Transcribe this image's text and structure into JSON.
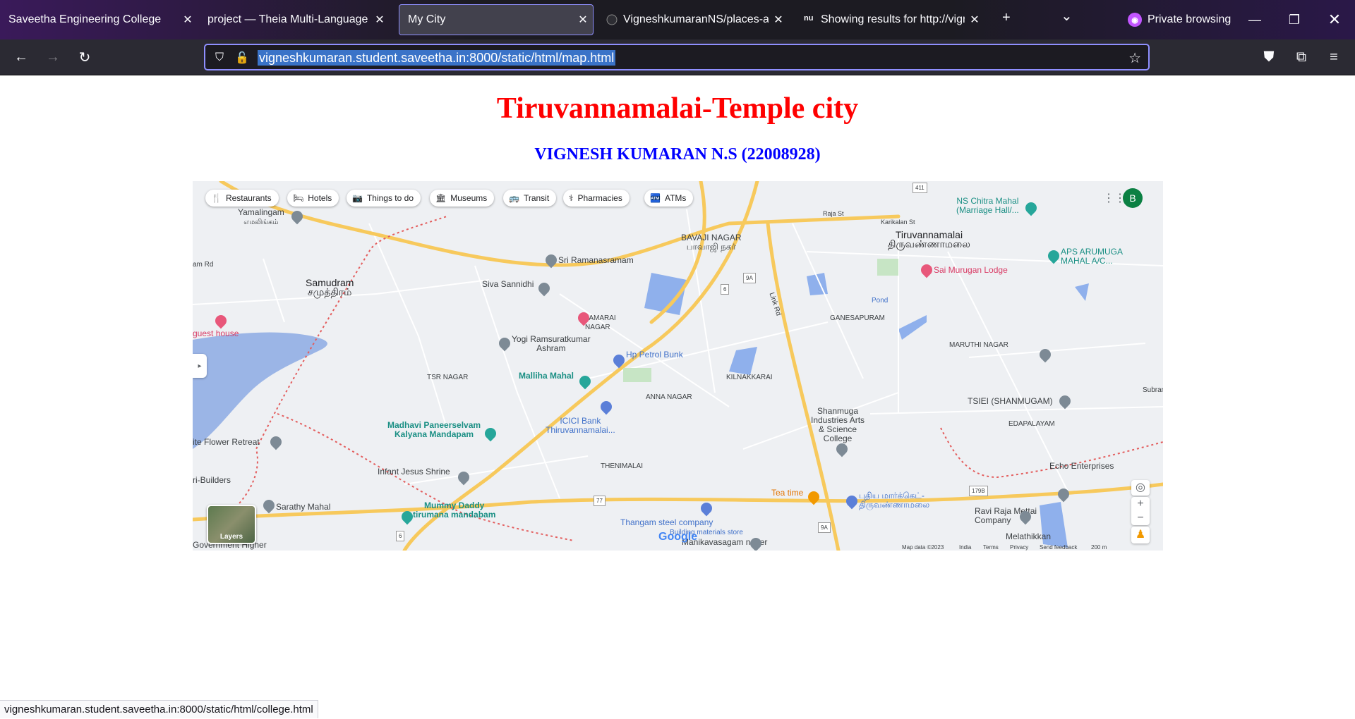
{
  "browser": {
    "tabs": [
      {
        "title": "Saveetha Engineering College",
        "icon": "saveetha-favicon",
        "active": false
      },
      {
        "title": "project — Theia Multi-Language Ex",
        "icon": "theia-favicon",
        "active": false
      },
      {
        "title": "My City",
        "icon": "page-favicon",
        "active": true
      },
      {
        "title": "VigneshkumaranNS/places-arou",
        "icon": "github-icon",
        "active": false
      },
      {
        "title": "Showing results for http://vigne",
        "icon": "nu-favicon",
        "active": false
      }
    ],
    "new_tab_symbol": "+",
    "tab_list_symbol": "⌄",
    "private_label": "Private browsing",
    "url": "vigneshkumaran.student.saveetha.in:8000/static/html/map.html",
    "status_url": "vigneshkumaran.student.saveetha.in:8000/static/html/college.html"
  },
  "page": {
    "title": "Tiruvannamalai-Temple city",
    "subtitle": "VIGNESH KUMARAN N.S (22008928)"
  },
  "map": {
    "chips": [
      {
        "label": "Restaurants",
        "icon": "fork-knife-icon"
      },
      {
        "label": "Hotels",
        "icon": "bed-icon"
      },
      {
        "label": "Things to do",
        "icon": "camera-icon"
      },
      {
        "label": "Museums",
        "icon": "museum-icon"
      },
      {
        "label": "Transit",
        "icon": "bus-icon"
      },
      {
        "label": "Pharmacies",
        "icon": "pharmacy-icon"
      },
      {
        "label": "ATMs",
        "icon": "atm-icon"
      }
    ],
    "avatar_letter": "B",
    "layers_label": "Layers",
    "places": {
      "yamalingam": "Yamalingam",
      "yamalingam_ta": "எமலிங்கம்",
      "samudram": "Samudram",
      "samudram_ta": "சமுத்திரம்",
      "bavaji_nagar": "BAVAJI NAGAR",
      "bavaji_nagar_ta": "பாவாஜி\nநகர்",
      "tiruvannamalai": "Tiruvannamalai",
      "tiruvannamalai_ta": "திருவண்ணாமலை",
      "sri_ramanasramam": "Sri Ramanasramam",
      "siva_sannidhi": "Siva Sannidhi",
      "sai_murugan_lodge": "Sai Murugan Lodge",
      "ns_chitra_mahal": "NS Chitra Mahal\n(Marriage Hall/...",
      "aps_arumuga": "APS ARUMUGA\nMAHAL A/C...",
      "thamarai_nagar": "THAMARAI\nNAGAR",
      "yogi_ashram": "Yogi Ramsuratkumar\nAshram",
      "hp_petrol_bunk": "Hp Petrol Bunk",
      "ganesapuram": "GANESAPURAM",
      "pond": "Pond",
      "maruthi_nagar": "MARUTHI NAGAR",
      "tsr_nagar": "TSR NAGAR",
      "malliha_mahal": "Malliha Mahal",
      "kilnakkarai": "KILNAKKARAI",
      "anna_nagar": "ANNA NAGAR",
      "icici_bank": "ICICI Bank\nThiruvannamalai...",
      "tsiei": "TSIEI (SHANMUGAM)",
      "madhavi": "Madhavi Paneerselvam\nKalyana Mandapam",
      "shanmuga": "Shanmuga\nIndustries Arts\n& Science\nCollege",
      "edapalayam": "EDAPALAYAM",
      "white_flower": "ite Flower Retreat",
      "guest_house": "guest house",
      "thenimalai": "THENIMALAI",
      "infant_jesus": "Infant Jesus Shrine",
      "echo_enterprises": "Echo Enterprises",
      "sarathy_mahal": "Sarathy Mahal",
      "mummy_daddy": "Mummy Daddy\ntirumana mandabam",
      "tea_time": "Tea time",
      "new_bus_stand_ta": "புதிய மார்க்கெட்-\nதிருவண்ணாமலை",
      "ravi_raja": "Ravi Raja Mettai\nCompany",
      "thangam_steel": "Thangam steel company",
      "building_materials": "Building materials store",
      "manikavasagam": "Manikavasagam nager",
      "melathikkan": "Melathikkan",
      "builders": "ri-Builders",
      "govt_higher": "Government Higher",
      "subram": "Subram",
      "link_rd": "Link Rd",
      "am_rd": "am Rd",
      "raja_st": "Raja St",
      "karikalan_st": "Karikalan St"
    },
    "road_shields": [
      "411",
      "6",
      "9A",
      "77",
      "179B",
      "6",
      "9A"
    ],
    "attribution": {
      "map_data": "Map data ©2023",
      "india": "India",
      "terms": "Terms",
      "privacy": "Privacy",
      "feedback": "Send feedback",
      "scale": "200 m"
    },
    "google": "Google"
  },
  "colors": {
    "title": "#ff0000",
    "subtitle": "#0000ff",
    "tab_accent": "#8f8fff",
    "chrome_bg": "#2b2a33"
  }
}
